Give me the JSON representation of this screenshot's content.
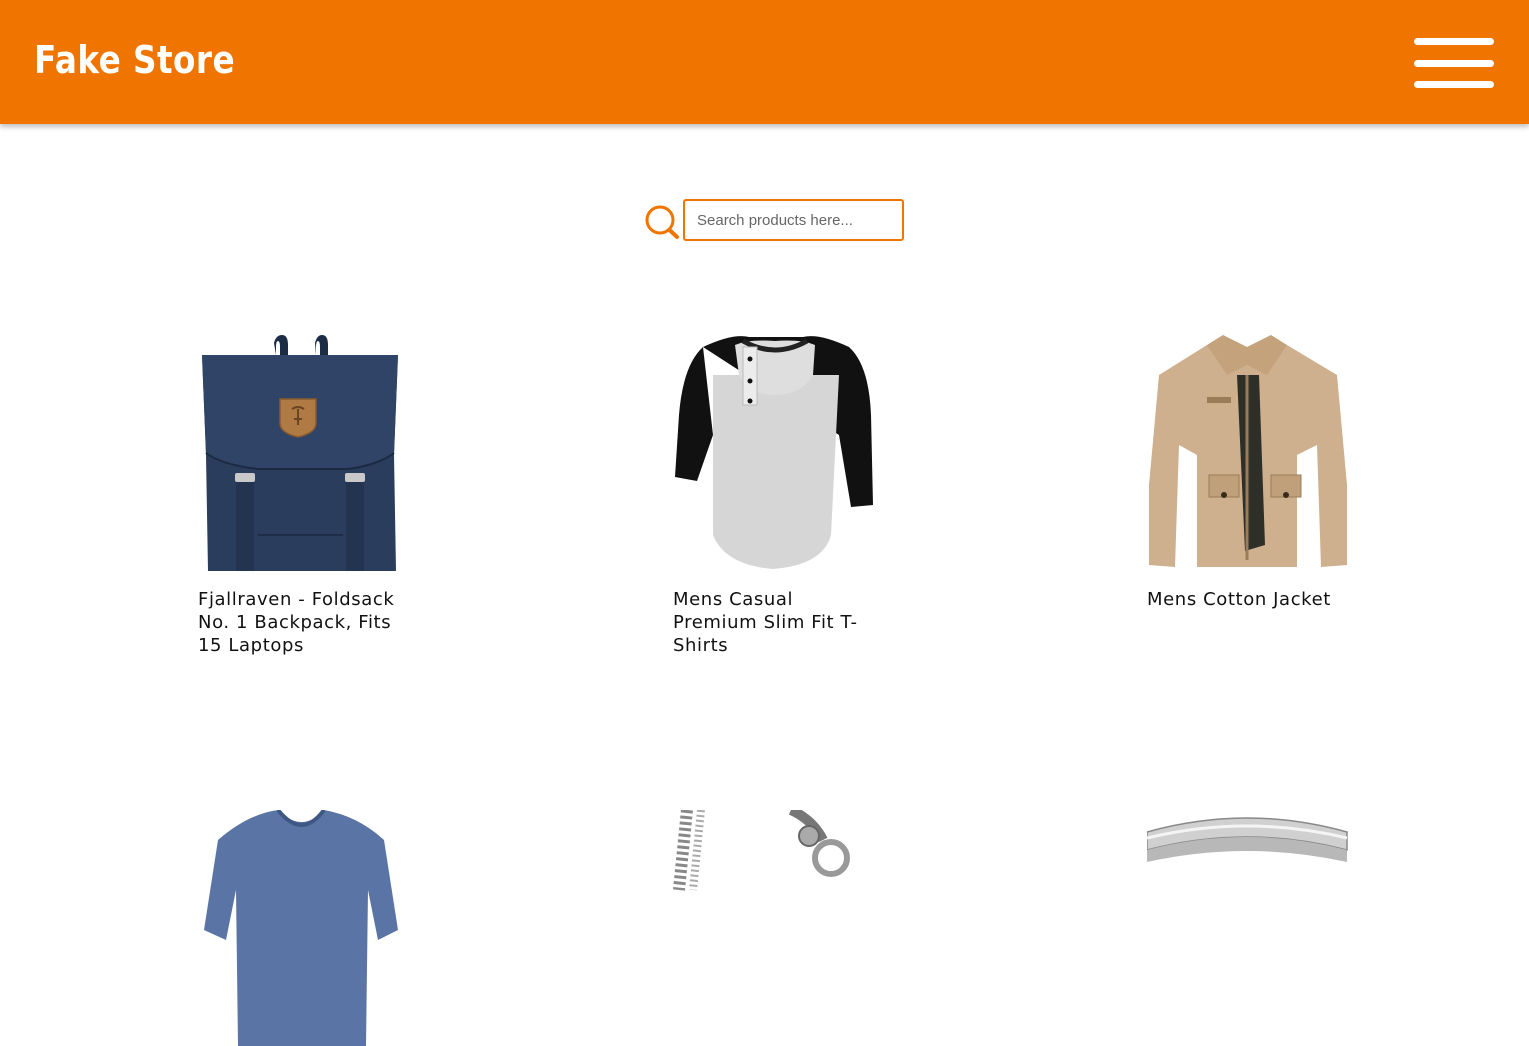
{
  "header": {
    "brand": "Fake Store",
    "menu_icon": "hamburger-menu-icon",
    "background": "#f07400"
  },
  "search": {
    "icon": "search-icon",
    "placeholder": "Search products here...",
    "value": ""
  },
  "products": [
    {
      "title": "Fjallraven - Foldsack No. 1 Backpack, Fits 15 Laptops",
      "image": "navy-backpack"
    },
    {
      "title": "Mens Casual Premium Slim Fit T-Shirts",
      "image": "raglan-henley-tshirt"
    },
    {
      "title": "Mens Cotton Jacket",
      "image": "khaki-cotton-jacket"
    },
    {
      "title": "",
      "image": "blue-vneck-sweater"
    },
    {
      "title": "",
      "image": "silver-dragon-bracelet"
    },
    {
      "title": "",
      "image": "silver-ring"
    }
  ],
  "colors": {
    "accent": "#f07400",
    "text": "#111111"
  }
}
